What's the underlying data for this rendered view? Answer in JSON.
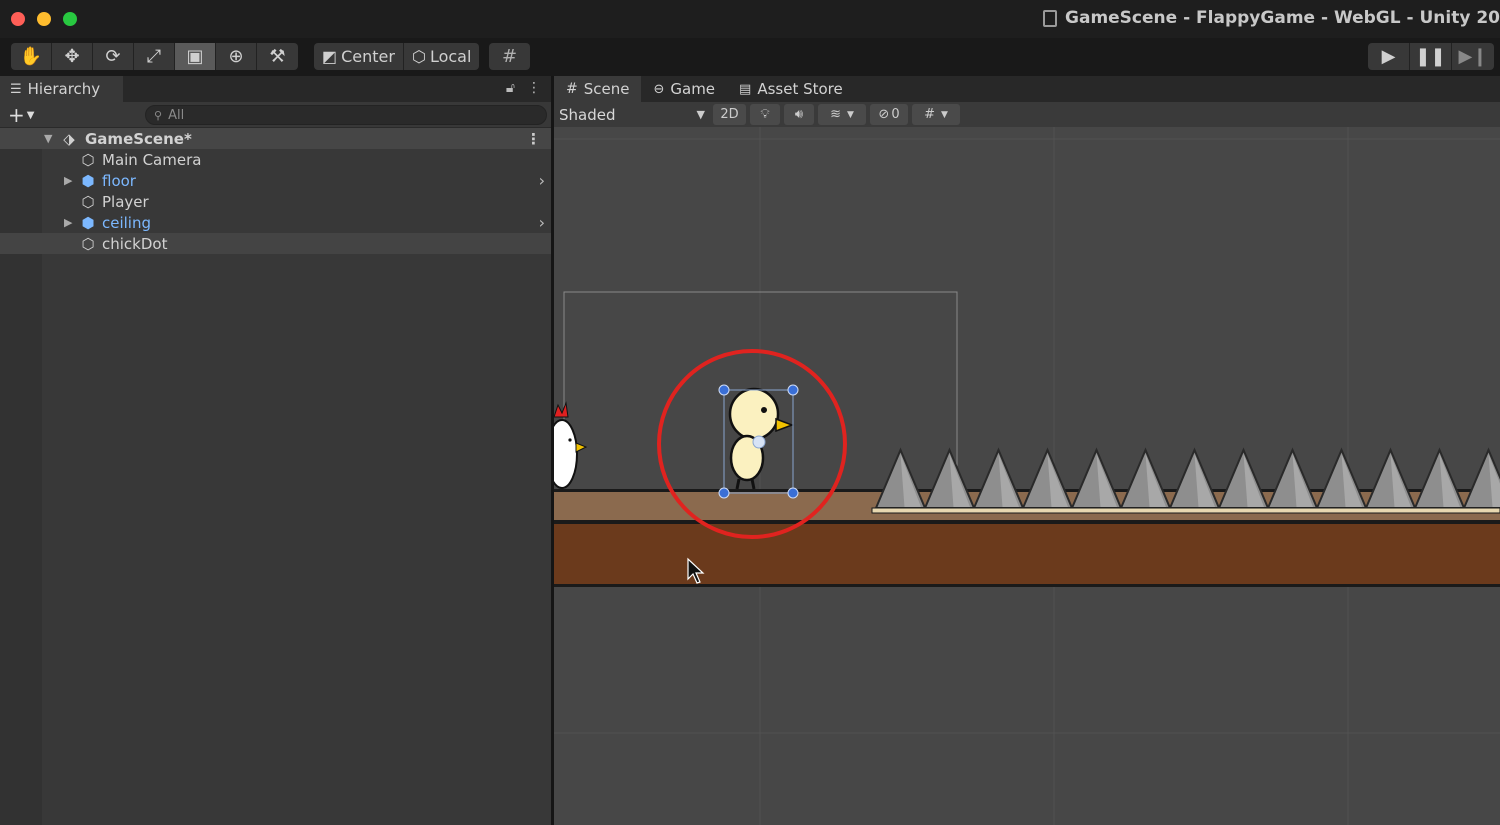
{
  "window": {
    "title": "GameScene - FlappyGame - WebGL - Unity 20"
  },
  "toolbar": {
    "tools": [
      "hand-icon",
      "move-icon",
      "rotate-icon",
      "scale-icon",
      "rect-tool-icon",
      "transform-icon",
      "custom-tool-icon"
    ],
    "active_tool": "rect-tool-icon",
    "pivot_label": "Center",
    "space_label": "Local",
    "grid_snap": "grid-snap-icon",
    "play": [
      "play-icon",
      "pause-icon",
      "step-icon"
    ]
  },
  "hierarchy": {
    "tab_label": "Hierarchy",
    "search_placeholder": "All",
    "scene_name": "GameScene*",
    "items": [
      {
        "label": "Main Camera",
        "prefab": false,
        "expandable": false
      },
      {
        "label": "floor",
        "prefab": true,
        "expandable": true
      },
      {
        "label": "Player",
        "prefab": false,
        "expandable": false
      },
      {
        "label": "ceiling",
        "prefab": true,
        "expandable": true
      },
      {
        "label": "chickDot",
        "prefab": false,
        "expandable": false,
        "selected": true
      }
    ]
  },
  "scene_view": {
    "tabs": [
      "Scene",
      "Game",
      "Asset Store"
    ],
    "active_tab": "Scene",
    "shading_mode": "Shaded",
    "mode_2d_label": "2D",
    "hidden_count": "0",
    "colors": {
      "background": "#474747",
      "floor_top": "#8b6a4e",
      "floor_bottom": "#6b3a1c",
      "spike": "#8e8e8e",
      "highlight_circle": "#e0231f",
      "handles": "#3a6fd6"
    }
  }
}
